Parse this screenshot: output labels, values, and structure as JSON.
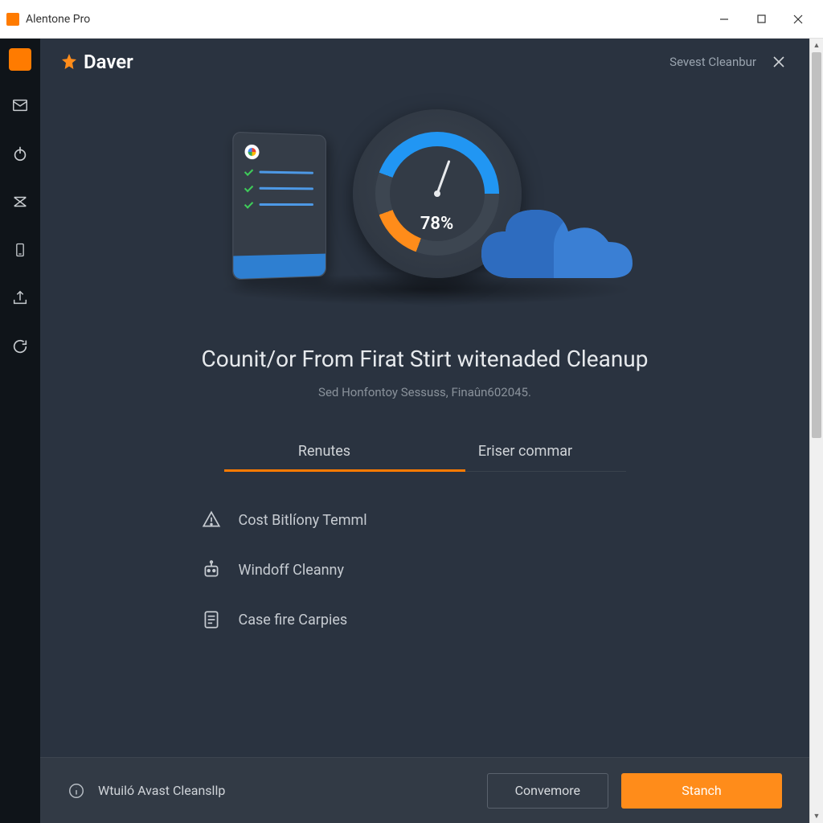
{
  "window": {
    "title": "Alentone Pro"
  },
  "header": {
    "brand": "Daver",
    "right_label": "Sevest Cleanbur"
  },
  "gauge": {
    "percent_label": "78%",
    "percent_value": 78
  },
  "headline": "Counit/or From Firat Stirt witenaded Cleanup",
  "subline": "Sed Honfontoy Sessuss, Finaûn602045.",
  "tabs": [
    {
      "label": "Renutes",
      "active": true
    },
    {
      "label": "Eriser commar",
      "active": false
    }
  ],
  "items": [
    {
      "icon": "alert-icon",
      "label": "Cost Bitlíony Temml"
    },
    {
      "icon": "robot-icon",
      "label": "Windoff Cleanny"
    },
    {
      "icon": "document-icon",
      "label": "Case fire Carpies"
    }
  ],
  "footer": {
    "label": "Wtuiló Avast Cleansllp",
    "secondary_button": "Convemore",
    "primary_button": "Stanch"
  },
  "colors": {
    "accent": "#ff8c1a",
    "bg": "#2a3340",
    "sidebar": "#0f1419"
  }
}
